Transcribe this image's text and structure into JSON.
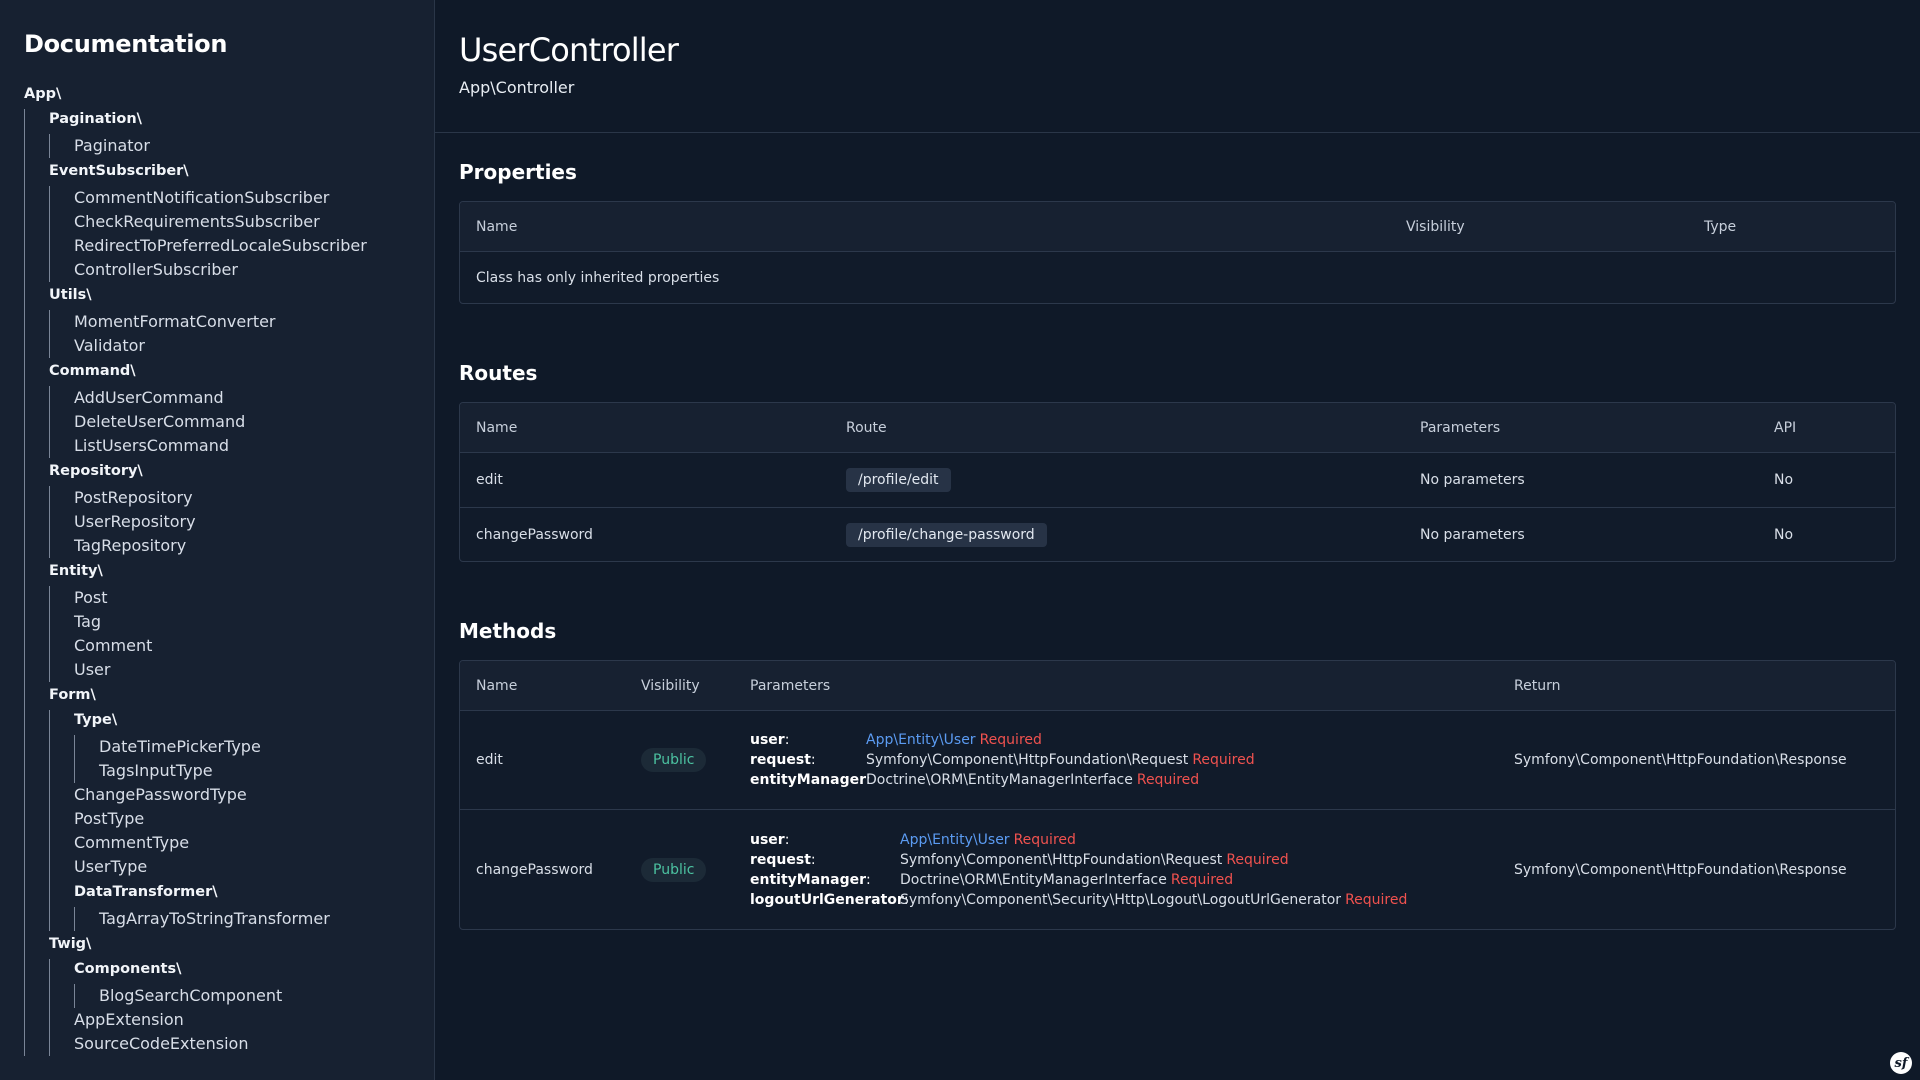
{
  "sidebar": {
    "title": "Documentation",
    "root": "App\\",
    "namespaces": {
      "pagination": {
        "label": "Pagination\\",
        "items": [
          "Paginator"
        ]
      },
      "eventsubscriber": {
        "label": "EventSubscriber\\",
        "items": [
          "CommentNotificationSubscriber",
          "CheckRequirementsSubscriber",
          "RedirectToPreferredLocaleSubscriber",
          "ControllerSubscriber"
        ]
      },
      "utils": {
        "label": "Utils\\",
        "items": [
          "MomentFormatConverter",
          "Validator"
        ]
      },
      "command": {
        "label": "Command\\",
        "items": [
          "AddUserCommand",
          "DeleteUserCommand",
          "ListUsersCommand"
        ]
      },
      "repository": {
        "label": "Repository\\",
        "items": [
          "PostRepository",
          "UserRepository",
          "TagRepository"
        ]
      },
      "entity": {
        "label": "Entity\\",
        "items": [
          "Post",
          "Tag",
          "Comment",
          "User"
        ]
      },
      "form": {
        "label": "Form\\",
        "type": {
          "label": "Type\\",
          "items": [
            "DateTimePickerType",
            "TagsInputType"
          ]
        },
        "items": [
          "ChangePasswordType",
          "PostType",
          "CommentType",
          "UserType"
        ],
        "datatransformer": {
          "label": "DataTransformer\\",
          "items": [
            "TagArrayToStringTransformer"
          ]
        }
      },
      "twig": {
        "label": "Twig\\",
        "components": {
          "label": "Components\\",
          "items": [
            "BlogSearchComponent"
          ]
        },
        "items": [
          "AppExtension",
          "SourceCodeExtension"
        ]
      }
    }
  },
  "header": {
    "title": "UserController",
    "namespace": "App\\Controller"
  },
  "properties": {
    "heading": "Properties",
    "columns": [
      "Name",
      "Visibility",
      "Type"
    ],
    "empty_message": "Class has only inherited properties"
  },
  "routes": {
    "heading": "Routes",
    "columns": [
      "Name",
      "Route",
      "Parameters",
      "API"
    ],
    "rows": [
      {
        "name": "edit",
        "route": "/profile/edit",
        "parameters": "No parameters",
        "api": "No"
      },
      {
        "name": "changePassword",
        "route": "/profile/change-password",
        "parameters": "No parameters",
        "api": "No"
      }
    ]
  },
  "methods": {
    "heading": "Methods",
    "columns": [
      "Name",
      "Visibility",
      "Parameters",
      "Return"
    ],
    "required_label": "Required",
    "rows": [
      {
        "name": "edit",
        "visibility": "Public",
        "params": [
          {
            "name": "user",
            "type": "App\\Entity\\User",
            "link": true
          },
          {
            "name": "request",
            "type": "Symfony\\Component\\HttpFoundation\\Request",
            "link": false
          },
          {
            "name": "entityManager",
            "type": "Doctrine\\ORM\\EntityManagerInterface",
            "link": false
          }
        ],
        "return": "Symfony\\Component\\HttpFoundation\\Response"
      },
      {
        "name": "changePassword",
        "visibility": "Public",
        "params": [
          {
            "name": "user",
            "type": "App\\Entity\\User",
            "link": true
          },
          {
            "name": "request",
            "type": "Symfony\\Component\\HttpFoundation\\Request",
            "link": false
          },
          {
            "name": "entityManager",
            "type": "Doctrine\\ORM\\EntityManagerInterface",
            "link": false
          },
          {
            "name": "logoutUrlGenerator",
            "type": "Symfony\\Component\\Security\\Http\\Logout\\LogoutUrlGenerator",
            "link": false
          }
        ],
        "return": "Symfony\\Component\\HttpFoundation\\Response"
      }
    ]
  },
  "logo": {
    "icon": "symfony-logo-icon",
    "glyph": "sf"
  },
  "colors": {
    "background": "#0f1928",
    "sidebar": "#172131",
    "link": "#5b9bf2",
    "required": "#f0524f",
    "public_badge": "#4cc2a1"
  }
}
